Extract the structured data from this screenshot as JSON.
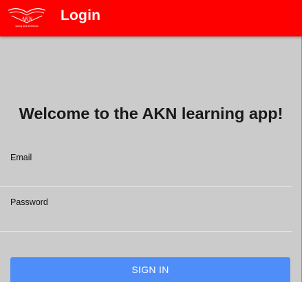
{
  "header": {
    "title": "Login",
    "logo_icon": "akn-logo-icon",
    "logo_text": "AKN",
    "logo_tagline": "young and ambitious",
    "background_color": "#fe0000"
  },
  "main": {
    "welcome_text": "Welcome to the AKN learning app!",
    "email": {
      "label": "Email",
      "value": ""
    },
    "password": {
      "label": "Password",
      "value": ""
    },
    "sign_in_label": "SIGN IN",
    "sign_in_color": "#4f8df9"
  }
}
